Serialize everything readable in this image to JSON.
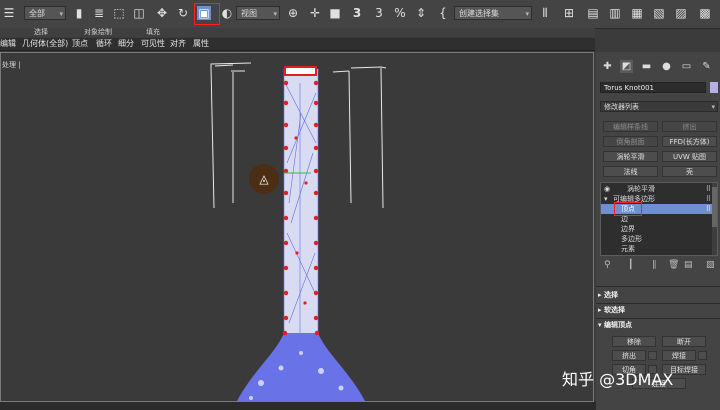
{
  "toolbar": {
    "selection_filter": "全部",
    "ref_coord": "视图",
    "named_selection_placeholder": "创建选择集",
    "snap_label": "3",
    "angle_snap_label": "3",
    "percent_snap_label": "%"
  },
  "ribbon": {
    "row1": [
      "选择",
      "对象绘制",
      "填充"
    ],
    "row2": [
      "编辑",
      "几何体(全部)",
      "顶点",
      "循环",
      "细分",
      "可见性",
      "对齐",
      "属性"
    ]
  },
  "viewport": {
    "label": "[前 ] [+] [默认明暗处理]",
    "visible_label": "处理 |"
  },
  "command_panel": {
    "object_name": "Torus Knot001",
    "object_color": "#b7b0e8",
    "modifier_list": "修改器列表",
    "buttons": [
      {
        "label": "编辑样条线",
        "enabled": false
      },
      {
        "label": "挤出",
        "enabled": false
      },
      {
        "label": "倒角剖面",
        "enabled": false
      },
      {
        "label": "FFD(长方体)",
        "enabled": true
      },
      {
        "label": "涡轮平滑",
        "enabled": true
      },
      {
        "label": "UVW 贴图",
        "enabled": true
      },
      {
        "label": "法线",
        "enabled": true
      },
      {
        "label": "壳",
        "enabled": true
      }
    ],
    "stack": [
      {
        "label": "涡轮平滑",
        "selected": false
      },
      {
        "label": "可编辑多边形",
        "selected": false
      },
      {
        "label": "顶点",
        "selected": true
      },
      {
        "label": "边",
        "selected": false
      },
      {
        "label": "边界",
        "selected": false
      },
      {
        "label": "多边形",
        "selected": false
      },
      {
        "label": "元素",
        "selected": false
      }
    ],
    "rollouts": [
      "选择",
      "软选择",
      "编辑顶点"
    ],
    "edit_vertex_buttons": [
      "移除",
      "断开",
      "挤出",
      "焊接",
      "切角",
      "目标焊接",
      "连接"
    ]
  },
  "watermark": "知乎 @3DMAX",
  "colors": {
    "highlight_red": "#ff2020",
    "selection_blue": "#6f8fd0",
    "vertex_red": "#e02020",
    "mesh_blue": "#6a72e8"
  }
}
